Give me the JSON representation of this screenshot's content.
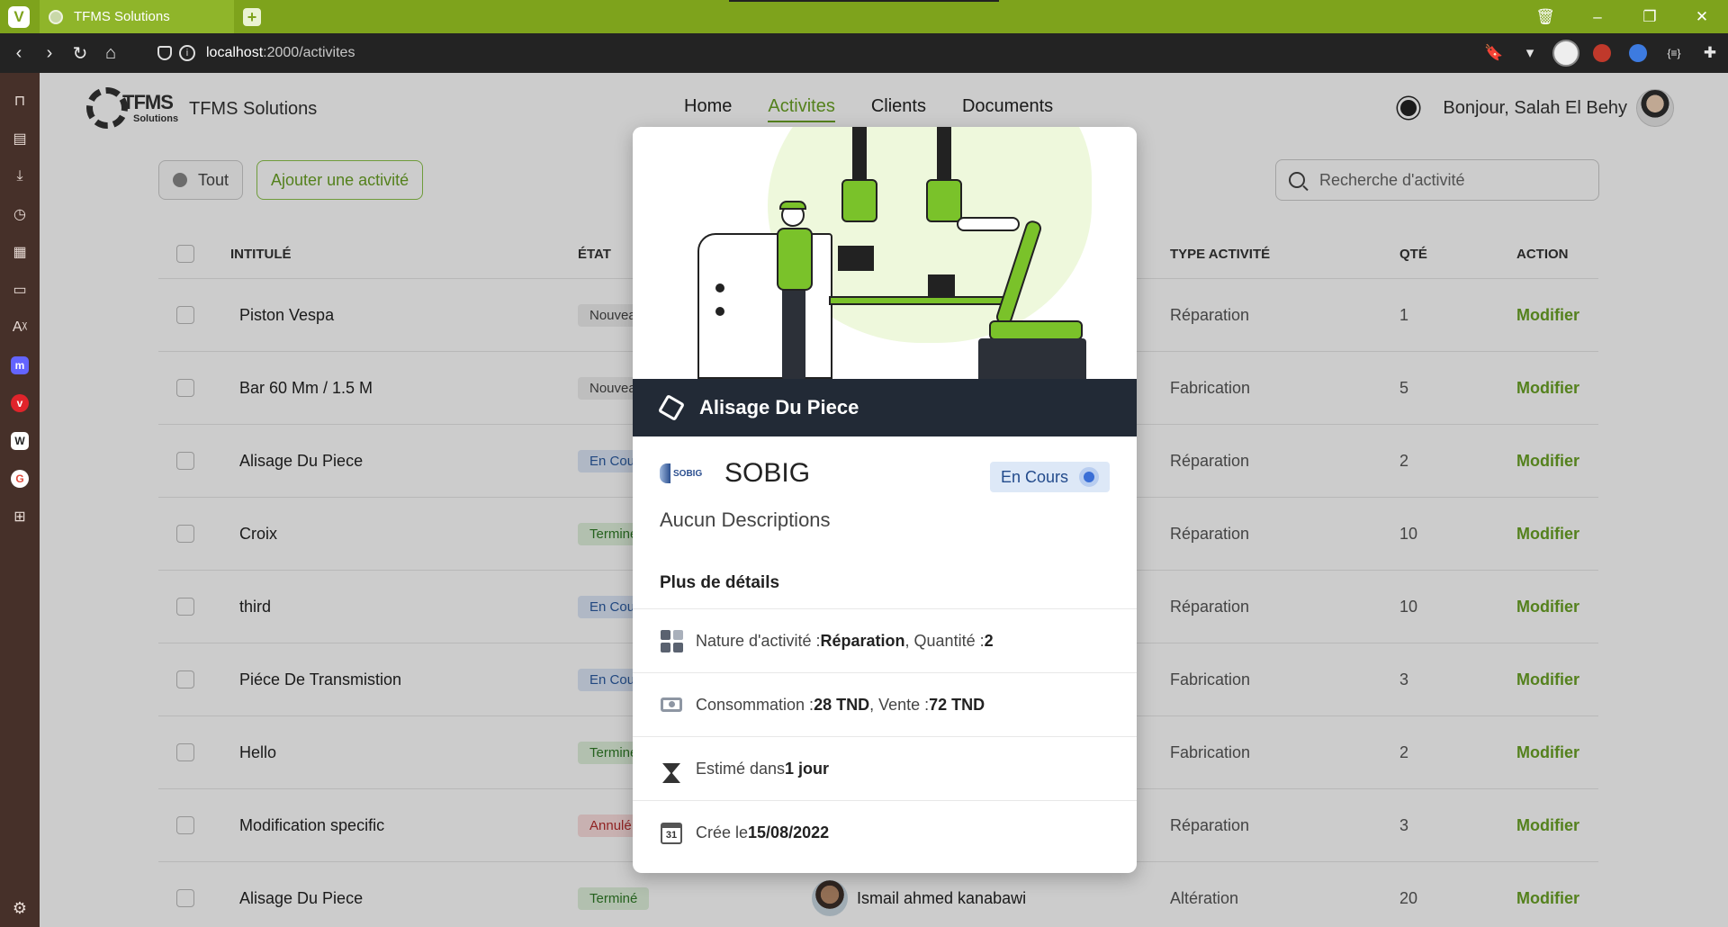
{
  "browser": {
    "tab_title": "TFMS Solutions",
    "url_host": "localhost",
    "url_path": ":2000/activites"
  },
  "colors": {
    "brand_green": "#6aa225",
    "browser_green": "#7ea31c",
    "dark_header": "#222a36"
  },
  "header": {
    "brand_logo_text": "TFMS",
    "brand_logo_sub": "Solutions",
    "brand_name": "TFMS Solutions",
    "nav": [
      "Home",
      "Activites",
      "Clients",
      "Documents"
    ],
    "active_nav": "Activites",
    "greeting": "Bonjour, Salah El Behy"
  },
  "toolbar": {
    "all_label": "Tout",
    "add_label": "Ajouter une activité",
    "search_placeholder": "Recherche d'activité"
  },
  "table": {
    "headers": {
      "title": "INTITULÉ",
      "etat": "ÉTAT",
      "type": "TYPE ACTIVITÉ",
      "qte": "QTÉ",
      "action": "ACTION"
    },
    "rows": [
      {
        "title": "Piston Vespa",
        "etat": "Nouveau",
        "etat_kind": "nouveau",
        "client": "",
        "type": "Réparation",
        "qte": "1",
        "action": "Modifier"
      },
      {
        "title": "Bar 60 Mm / 1.5 M",
        "etat": "Nouveau",
        "etat_kind": "nouveau",
        "client": "",
        "type": "Fabrication",
        "qte": "5",
        "action": "Modifier"
      },
      {
        "title": "Alisage Du Piece",
        "etat": "En Cours",
        "etat_kind": "encours",
        "client": "",
        "type": "Réparation",
        "qte": "2",
        "action": "Modifier"
      },
      {
        "title": "Croix",
        "etat": "Terminé",
        "etat_kind": "termine",
        "client": "",
        "type": "Réparation",
        "qte": "10",
        "action": "Modifier"
      },
      {
        "title": "third",
        "etat": "En Cours",
        "etat_kind": "encours",
        "client": "",
        "type": "Réparation",
        "qte": "10",
        "action": "Modifier"
      },
      {
        "title": "Piéce De Transmistion",
        "etat": "En Cours",
        "etat_kind": "encours",
        "client": "",
        "type": "Fabrication",
        "qte": "3",
        "action": "Modifier"
      },
      {
        "title": "Hello",
        "etat": "Terminé",
        "etat_kind": "termine",
        "client": "",
        "type": "Fabrication",
        "qte": "2",
        "action": "Modifier"
      },
      {
        "title": "Modification specific",
        "etat": "Annulé",
        "etat_kind": "annule",
        "client": "",
        "type": "Réparation",
        "qte": "3",
        "action": "Modifier"
      },
      {
        "title": "Alisage Du Piece",
        "etat": "Terminé",
        "etat_kind": "termine",
        "client": "Ismail ahmed kanabawi",
        "type": "Altération",
        "qte": "20",
        "action": "Modifier"
      }
    ]
  },
  "modal": {
    "title": "Alisage Du Piece",
    "client_logo_text": "SOBIG",
    "client": "SOBIG",
    "status": "En Cours",
    "description": "Aucun Descriptions",
    "more_label": "Plus de détails",
    "nature_label": "Nature d'activité : ",
    "nature_value": "Réparation",
    "qty_label": ", Quantité : ",
    "qty_value": "2",
    "conso_label": "Consommation : ",
    "conso_value": "28 TND",
    "vente_label": ", Vente : ",
    "vente_value": "72 TND",
    "estime_label": "Estimé dans ",
    "estime_value": "1 jour",
    "cree_label": "Crée le ",
    "cree_value": "15/08/2022",
    "calendar_day": "31"
  }
}
